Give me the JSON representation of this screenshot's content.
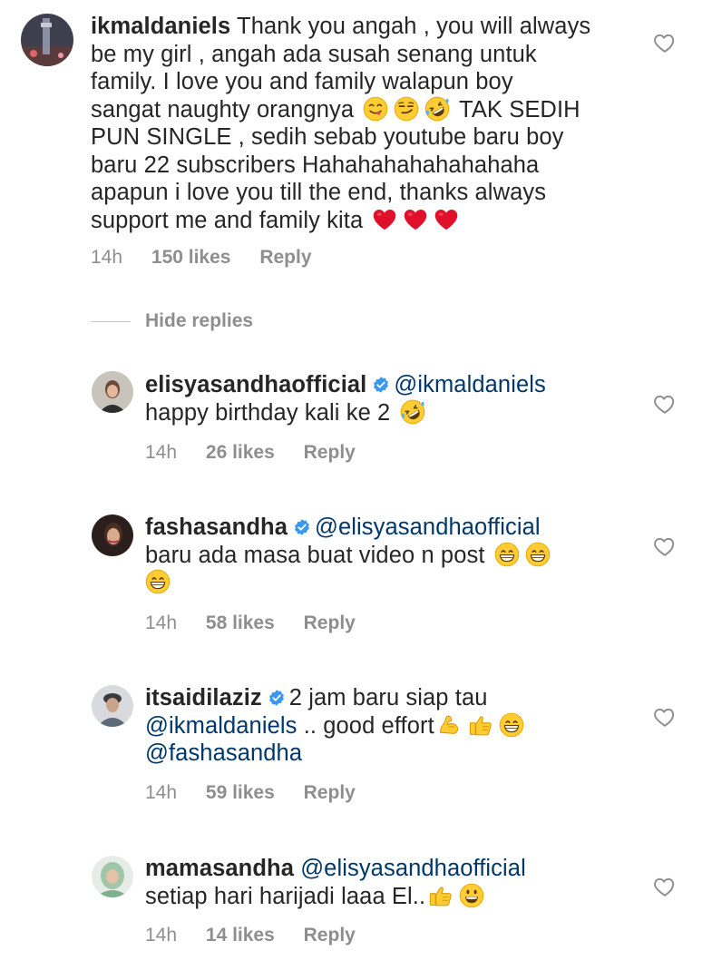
{
  "main_comment": {
    "username": "ikmaldaniels",
    "lines": [
      "Thank you angah , you will always",
      "be my girl , angah ada susah senang untuk",
      "family. I love you and family walapun boy",
      "sangat naughty orangnya",
      "TAK SEDIH",
      "PUN SINGLE , sedih sebab youtube baru boy",
      "baru 22 subscribers Hahahahahahahahaha",
      "apapun i love you till the end, thanks always",
      "support me and family kita"
    ],
    "time": "14h",
    "likes": "150 likes",
    "reply": "Reply"
  },
  "hide_replies": "Hide replies",
  "replies": [
    {
      "username": "elisyasandhaofficial",
      "mention": "@ikmaldaniels",
      "lines": [
        "happy birthday kali ke 2"
      ],
      "time": "14h",
      "likes": "26 likes",
      "reply": "Reply"
    },
    {
      "username": "fashasandha",
      "mention": "@elisyasandhaofficial",
      "lines": [
        "baru ada masa buat video n post"
      ],
      "time": "14h",
      "likes": "58 likes",
      "reply": "Reply"
    },
    {
      "username": "itsaidilaziz",
      "lines": [
        "2 jam baru siap tau",
        ".. good effort"
      ],
      "mentions": [
        "@ikmaldaniels",
        "@fashasandha"
      ],
      "time": "14h",
      "likes": "59 likes",
      "reply": "Reply"
    },
    {
      "username": "mamasandha",
      "mention": "@elisyasandhaofficial",
      "lines": [
        "setiap hari harijadi laaa  El.."
      ],
      "time": "14h",
      "likes": "14 likes",
      "reply": "Reply"
    }
  ],
  "colors": {
    "text": "#262626",
    "secondary": "#8e8e8e",
    "mention": "#00376b",
    "verified": "#3897f0"
  },
  "icons": [
    "heart-outline-icon",
    "verified-badge-icon",
    "red-heart-emoji",
    "grin-emoji",
    "yum-emoji",
    "smirk-emoji",
    "rofl-emoji",
    "flexed-biceps-emoji",
    "thumbs-up-emoji",
    "grinning-emoji"
  ]
}
